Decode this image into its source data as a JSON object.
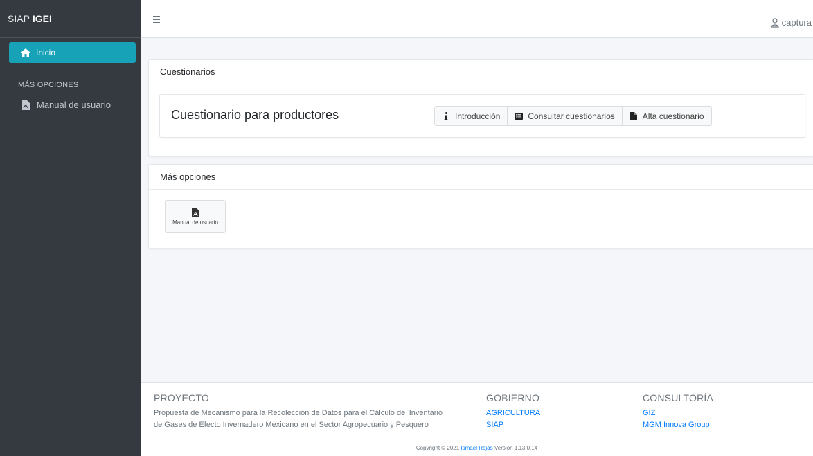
{
  "sidebar": {
    "brand_prefix": "SIAP",
    "brand_bold": "IGEI",
    "active_item": {
      "label": "Inicio",
      "icon": "home-icon"
    },
    "section_header": "MÁS OPCIONES",
    "items": [
      {
        "label": "Manual de usuario",
        "icon": "file-pdf-icon"
      }
    ]
  },
  "topbar": {
    "user": "captura",
    "menu_icon": "hamburger-icon",
    "user_icon": "user-icon"
  },
  "cuestionarios": {
    "header": "Cuestionarios",
    "title": "Cuestionario para productores",
    "buttons": [
      {
        "label": "Introducción",
        "icon": "info-icon"
      },
      {
        "label": "Consultar cuestionarios",
        "icon": "list-icon"
      },
      {
        "label": "Alta cuestionario",
        "icon": "file-icon"
      }
    ]
  },
  "mas_opciones": {
    "header": "Más opciones",
    "tile": {
      "label": "Manual de usuario",
      "icon": "file-pdf-icon"
    }
  },
  "footer": {
    "proyecto": {
      "heading": "PROYECTO",
      "line1": "Propuesta de Mecanismo para la Recolección de Datos para el Cálculo del Inventario",
      "line2": "de Gases de Efecto Invernadero Mexicano en el Sector Agropecuario y Pesquero"
    },
    "gobierno": {
      "heading": "GOBIERNO",
      "links": [
        "AGRICULTURA",
        "SIAP"
      ]
    },
    "consultoria": {
      "heading": "CONSULTORÍA",
      "links": [
        "GIZ",
        "MGM Innova Group"
      ]
    },
    "copyright_prefix": "Copyright © 2021",
    "author": "Ismael Rojas",
    "version": "Versión 1.13.0.14"
  },
  "colors": {
    "sidebar_bg": "#343a40",
    "active": "#17a2b8",
    "link": "#007bff"
  }
}
